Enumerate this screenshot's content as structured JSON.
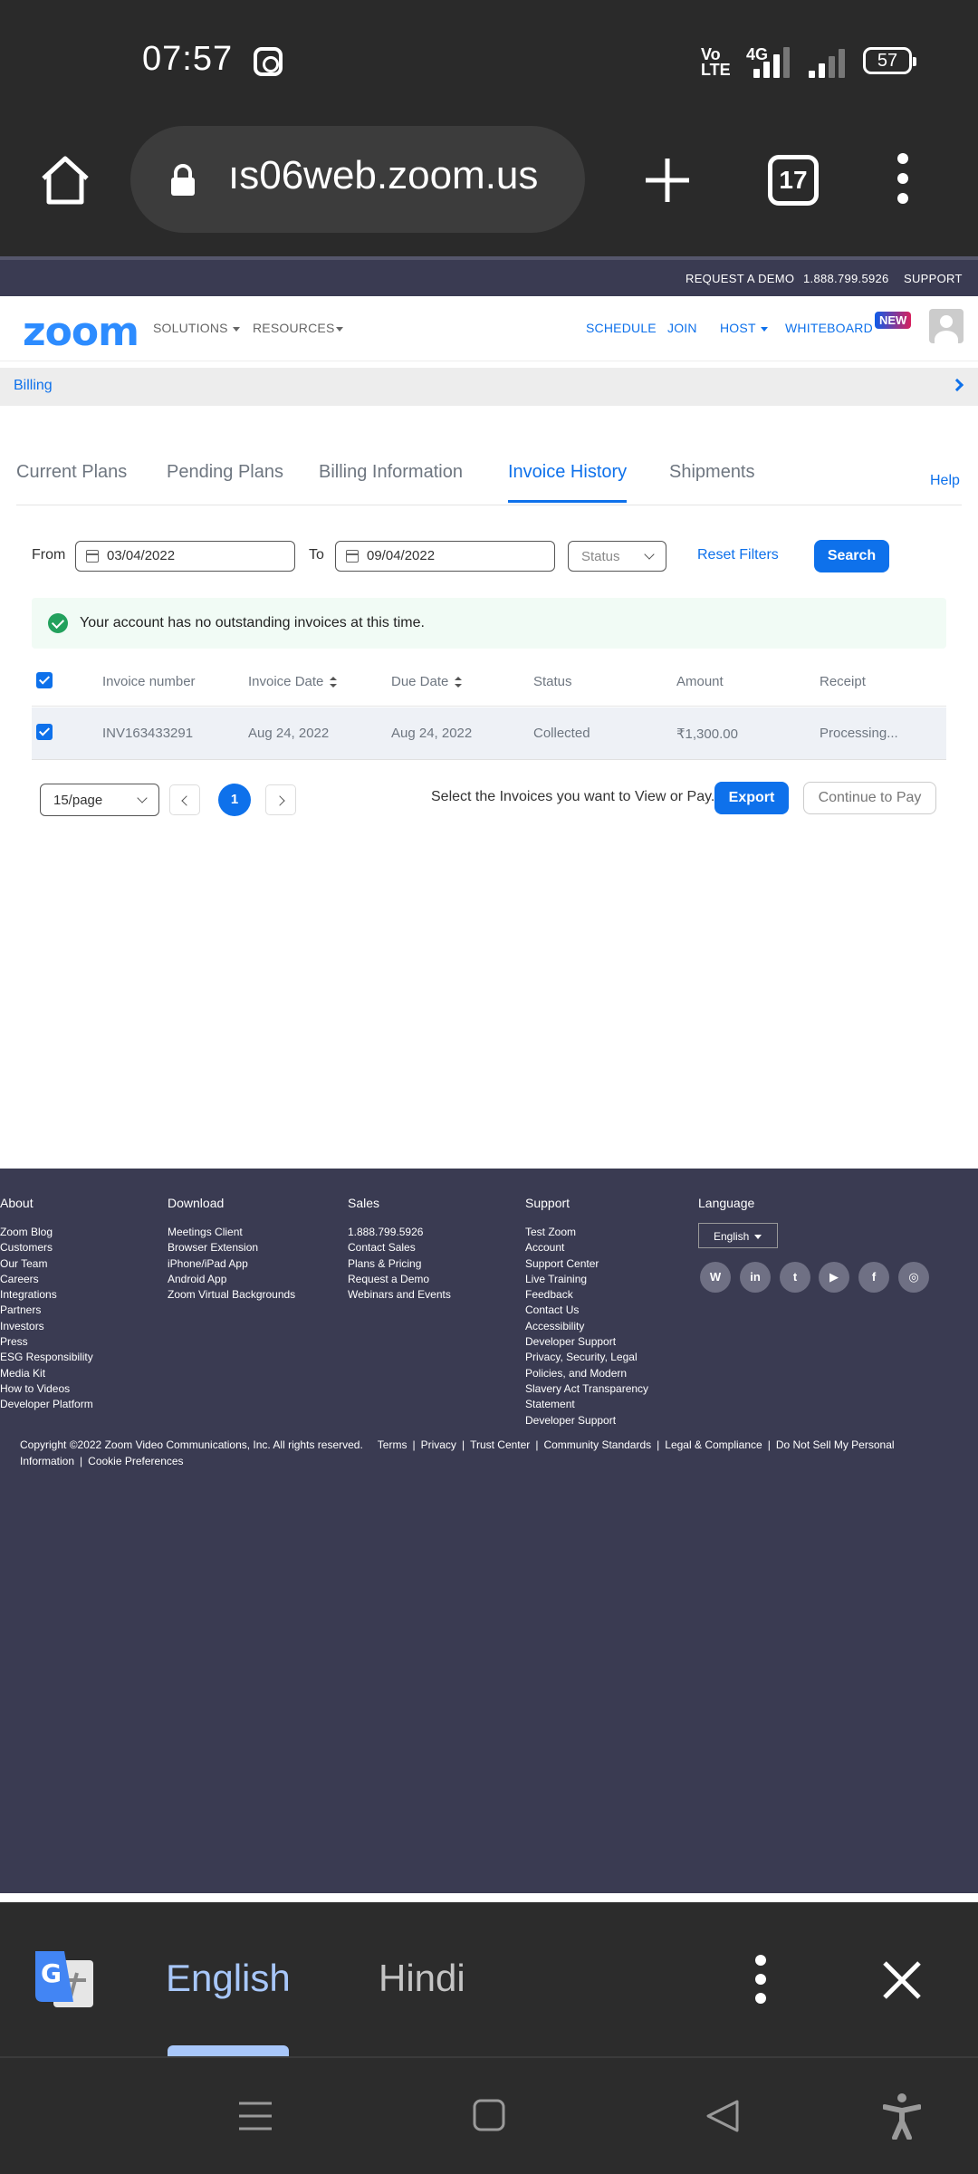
{
  "status_bar": {
    "time": "07:57",
    "volte": "Vo\nLTE",
    "network": "4G",
    "battery": "57"
  },
  "browser": {
    "url": "ıs06web.zoom.us",
    "tab_count": "17"
  },
  "zoom_top": {
    "request_demo": "REQUEST A DEMO",
    "phone": "1.888.799.5926",
    "support": "SUPPORT"
  },
  "zoom_nav": {
    "logo": "zoom",
    "solutions": "SOLUTIONS",
    "resources": "RESOURCES",
    "schedule": "SCHEDULE",
    "join": "JOIN",
    "host": "HOST",
    "whiteboard": "WHITEBOARD",
    "new_badge": "NEW"
  },
  "breadcrumb": {
    "label": "Billing"
  },
  "tabs": [
    {
      "label": "Current Plans"
    },
    {
      "label": "Pending Plans"
    },
    {
      "label": "Billing Information"
    },
    {
      "label": "Invoice History"
    },
    {
      "label": "Shipments"
    }
  ],
  "help": "Help",
  "filters": {
    "from_label": "From",
    "from_value": "03/04/2022",
    "to_label": "To",
    "to_value": "09/04/2022",
    "status_placeholder": "Status",
    "reset_label": "Reset Filters",
    "search_label": "Search"
  },
  "notice": "Your account has no outstanding invoices at this time.",
  "table": {
    "headers": [
      "Invoice number",
      "Invoice Date",
      "Due Date",
      "Status",
      "Amount",
      "Receipt"
    ],
    "rows": [
      {
        "invoice_number": "INV163433291",
        "invoice_date": "Aug 24, 2022",
        "due_date": "Aug 24, 2022",
        "status": "Collected",
        "amount": "₹1,300.00",
        "receipt": "Processing..."
      }
    ]
  },
  "pager": {
    "per_page": "15/page",
    "current_page": "1",
    "hint": "Select the Invoices you want to View or Pay.",
    "export_label": "Export",
    "continue_label": "Continue to Pay"
  },
  "footer": {
    "about": {
      "title": "About",
      "items": [
        "Zoom Blog",
        "Customers",
        "Our Team",
        "Careers",
        "Integrations",
        "Partners",
        "Investors",
        "Press",
        "ESG Responsibility",
        "Media Kit",
        "How to Videos",
        "Developer Platform"
      ]
    },
    "download": {
      "title": "Download",
      "items": [
        "Meetings Client",
        "Browser Extension",
        "iPhone/iPad App",
        "Android App",
        "Zoom Virtual Backgrounds"
      ]
    },
    "sales": {
      "title": "Sales",
      "items": [
        "1.888.799.5926",
        "Contact Sales",
        "Plans & Pricing",
        "Request a Demo",
        "Webinars and Events"
      ]
    },
    "support": {
      "title": "Support",
      "items": [
        "Test Zoom",
        "Account",
        "Support Center",
        "Live Training",
        "Feedback",
        "Contact Us",
        "Accessibility",
        "Developer Support",
        "Privacy, Security, Legal",
        "Policies, and Modern",
        "Slavery Act Transparency",
        "Statement",
        "Developer Support"
      ]
    },
    "language": {
      "title": "Language",
      "selected": "English"
    },
    "social_icons": [
      "wordpress-icon",
      "linkedin-icon",
      "twitter-icon",
      "youtube-icon",
      "facebook-icon",
      "instagram-icon"
    ],
    "copyright": "Copyright ©2022 Zoom Video Communications, Inc. All rights reserved.",
    "legal_links": [
      "Terms",
      "Privacy",
      "Trust Center",
      "Community Standards",
      "Legal & Compliance",
      "Do Not Sell My Personal Information",
      "Cookie Preferences"
    ]
  },
  "translate": {
    "source": "English",
    "target": "Hindi"
  },
  "colors": {
    "accent": "#0e71eb",
    "footer_bg": "#3a3b52",
    "success": "#23a15d"
  }
}
